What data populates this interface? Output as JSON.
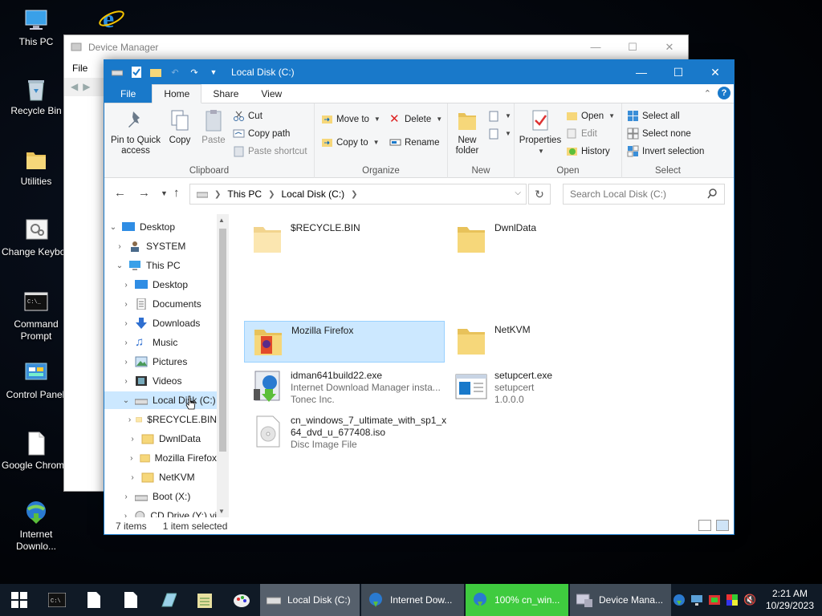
{
  "desktop": {
    "icons": [
      {
        "label": "This PC"
      },
      {
        "label": ""
      },
      {
        "label": "Recycle Bin"
      },
      {
        "label": "Utilities"
      },
      {
        "label": "Change Keyboard Layo..."
      },
      {
        "label": "Command Prompt"
      },
      {
        "label": "Control Panel"
      },
      {
        "label": "Google Chrome"
      },
      {
        "label": "Internet Downlo..."
      }
    ]
  },
  "device_manager": {
    "title": "Device Manager",
    "menu_file": "File"
  },
  "explorer": {
    "title": "Local Disk (C:)",
    "tabs": [
      "File",
      "Home",
      "Share",
      "View"
    ],
    "ribbon": {
      "clipboard": {
        "label": "Clipboard",
        "pin": "Pin to Quick access",
        "copy": "Copy",
        "paste": "Paste",
        "cut": "Cut",
        "copy_path": "Copy path",
        "paste_shortcut": "Paste shortcut"
      },
      "organize": {
        "label": "Organize",
        "move_to": "Move to",
        "copy_to": "Copy to",
        "delete": "Delete",
        "rename": "Rename"
      },
      "new": {
        "label": "New",
        "new_folder": "New folder"
      },
      "open": {
        "label": "Open",
        "properties": "Properties",
        "open": "Open",
        "edit": "Edit",
        "history": "History"
      },
      "select": {
        "label": "Select",
        "select_all": "Select all",
        "select_none": "Select none",
        "invert": "Invert selection"
      }
    },
    "address": {
      "crumbs": [
        "This PC",
        "Local Disk (C:)"
      ],
      "search_placeholder": "Search Local Disk (C:)"
    },
    "tree": [
      {
        "label": "Desktop"
      },
      {
        "label": "SYSTEM"
      },
      {
        "label": "This PC"
      },
      {
        "label": "Desktop"
      },
      {
        "label": "Documents"
      },
      {
        "label": "Downloads"
      },
      {
        "label": "Music"
      },
      {
        "label": "Pictures"
      },
      {
        "label": "Videos"
      },
      {
        "label": "Local Disk (C:)"
      },
      {
        "label": "$RECYCLE.BIN"
      },
      {
        "label": "DwnlData"
      },
      {
        "label": "Mozilla Firefox"
      },
      {
        "label": "NetKVM"
      },
      {
        "label": "Boot (X:)"
      },
      {
        "label": "CD Drive (Y:) vi"
      }
    ],
    "files": [
      {
        "name": "$RECYCLE.BIN",
        "line2": "",
        "line3": ""
      },
      {
        "name": "DwnlData",
        "line2": "",
        "line3": ""
      },
      {
        "name": "Mozilla Firefox",
        "line2": "",
        "line3": ""
      },
      {
        "name": "NetKVM",
        "line2": "",
        "line3": ""
      },
      {
        "name": "idman641build22.exe",
        "line2": "Internet Download Manager insta...",
        "line3": "Tonec Inc."
      },
      {
        "name": "setupcert.exe",
        "line2": "setupcert",
        "line3": "1.0.0.0"
      },
      {
        "name": "cn_windows_7_ultimate_with_sp1_x",
        "line2": "64_dvd_u_677408.iso",
        "line3": "Disc Image File"
      }
    ],
    "status": {
      "items": "7 items",
      "selected": "1 item selected"
    }
  },
  "taskbar": {
    "tasks": [
      {
        "label": "Local Disk (C:)"
      },
      {
        "label": "Internet Dow..."
      },
      {
        "label": "100% cn_win..."
      },
      {
        "label": "Device Mana..."
      }
    ],
    "clock": {
      "time": "2:21 AM",
      "date": "10/29/2023"
    }
  },
  "colors": {
    "accent": "#1979ca",
    "selection": "#cce8ff",
    "download_green": "#3fcb3f"
  }
}
